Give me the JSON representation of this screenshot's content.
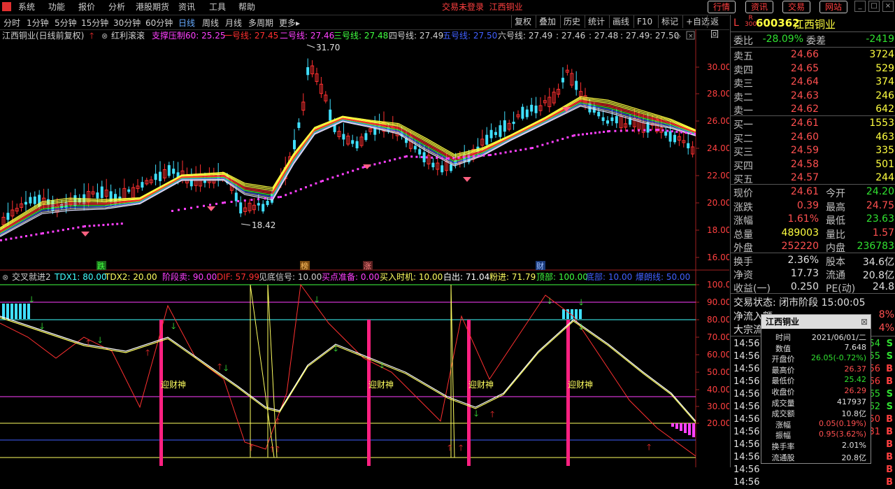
{
  "menu": [
    "系统",
    "功能",
    "报价",
    "分析",
    "港股期货",
    "资讯",
    "工具",
    "帮助"
  ],
  "login_notice": "交易未登录",
  "login_stock": "江西铜业",
  "top_buttons": [
    "行情",
    "资讯",
    "交易",
    "网站"
  ],
  "periods": [
    "分时",
    "1分钟",
    "5分钟",
    "15分钟",
    "30分钟",
    "60分钟",
    "日线",
    "周线",
    "月线",
    "多周期",
    "更多"
  ],
  "tools": [
    "复权",
    "叠加",
    "历史",
    "统计",
    "画线",
    "F10",
    "标记",
    "+自选",
    "返回"
  ],
  "main_legend": {
    "title": "江西铜业(日线前复权)",
    "indicator": "红利滚滚",
    "items": [
      {
        "text": "支撑压制60: 25.25",
        "color": "#ff40ff"
      },
      {
        "text": "一号线: 27.45",
        "color": "#ff3030"
      },
      {
        "text": "二号线: 27.46",
        "color": "#ff40ff"
      },
      {
        "text": "三号线: 27.48",
        "color": "#40ff40"
      },
      {
        "text": "四号线: 27.49",
        "color": "#d0d0d0"
      },
      {
        "text": "五号线: 27.50",
        "color": "#4060ff"
      },
      {
        "text": "六号线: 27.49",
        "color": "#d0d0d0"
      },
      {
        "text": ": 27.46",
        "color": "#d0d0d0"
      },
      {
        "text": ": 27.48",
        "color": "#d0d0d0"
      },
      {
        "text": ": 27.49",
        "color": "#d0d0d0"
      },
      {
        "text": ": 27.50",
        "color": "#d0d0d0"
      }
    ]
  },
  "sub_legend": {
    "title": "交叉就进2",
    "items": [
      {
        "text": "TDX1: 80.00",
        "color": "#40ffff"
      },
      {
        "text": "TDX2: 20.00",
        "color": "#ffff60"
      },
      {
        "text": "阶段卖: 90.00",
        "color": "#ff40ff"
      },
      {
        "text": "DIF: 57.99",
        "color": "#ff3030"
      },
      {
        "text": "见底信号: 10.00",
        "color": "#d0d0d0"
      },
      {
        "text": "买点准备: 0.00",
        "color": "#ff40ff"
      },
      {
        "text": "买入时机: 10.00",
        "color": "#ffff60"
      },
      {
        "text": "白出: 71.04",
        "color": "#ffffff"
      },
      {
        "text": "粉进: 71.79",
        "color": "#ffff60"
      },
      {
        "text": "顶部: 100.00",
        "color": "#40ff40"
      },
      {
        "text": "底部: 10.00",
        "color": "#4060ff"
      },
      {
        "text": "爆朗线: 50.00",
        "color": "#4060ff"
      }
    ]
  },
  "price_axis": [
    "30.00",
    "28.00",
    "26.00",
    "24.00",
    "22.00",
    "20.00",
    "18.00",
    "16.00"
  ],
  "sub_axis": [
    "100.00",
    "90.00",
    "80.00",
    "70.00",
    "60.00",
    "50.00",
    "40.00",
    "30.00",
    "20.00"
  ],
  "annotations": {
    "high": "31.70",
    "low": "18.42",
    "tags": [
      "跌",
      "榜",
      "涨",
      "财"
    ],
    "signal": "迎财神"
  },
  "quote": {
    "code": "600362",
    "name": "江西铜业",
    "board_label": "R",
    "board_sub": "300",
    "weibi_label": "委比",
    "weibi": "-28.09%",
    "weicha_label": "委差",
    "weicha": "-2419",
    "sells": [
      {
        "label": "卖五",
        "price": "24.66",
        "vol": "3724"
      },
      {
        "label": "卖四",
        "price": "24.65",
        "vol": "529"
      },
      {
        "label": "卖三",
        "price": "24.64",
        "vol": "374"
      },
      {
        "label": "卖二",
        "price": "24.63",
        "vol": "246"
      },
      {
        "label": "卖一",
        "price": "24.62",
        "vol": "642"
      }
    ],
    "buys": [
      {
        "label": "买一",
        "price": "24.61",
        "vol": "1553"
      },
      {
        "label": "买二",
        "price": "24.60",
        "vol": "463"
      },
      {
        "label": "买三",
        "price": "24.59",
        "vol": "335"
      },
      {
        "label": "买四",
        "price": "24.58",
        "vol": "501"
      },
      {
        "label": "买五",
        "price": "24.57",
        "vol": "244"
      }
    ],
    "stats": [
      {
        "l1": "现价",
        "v1": "24.61",
        "c1": "red",
        "l2": "今开",
        "v2": "24.20",
        "c2": "green"
      },
      {
        "l1": "涨跌",
        "v1": "0.39",
        "c1": "red",
        "l2": "最高",
        "v2": "24.75",
        "c2": "red"
      },
      {
        "l1": "涨幅",
        "v1": "1.61%",
        "c1": "red",
        "l2": "最低",
        "v2": "23.63",
        "c2": "green"
      },
      {
        "l1": "总量",
        "v1": "489003",
        "c1": "yellow",
        "l2": "量比",
        "v2": "1.57",
        "c2": "red"
      },
      {
        "l1": "外盘",
        "v1": "252220",
        "c1": "red",
        "l2": "内盘",
        "v2": "236783",
        "c2": "green"
      }
    ],
    "stats2": [
      {
        "l1": "换手",
        "v1": "2.36%",
        "l2": "股本",
        "v2": "34.6亿"
      },
      {
        "l1": "净资",
        "v1": "17.73",
        "l2": "流通",
        "v2": "20.8亿"
      },
      {
        "l1": "收益(一)",
        "v1": "0.250",
        "l2": "PE(动)",
        "v2": "24.8"
      }
    ],
    "status": "交易状态: 闭市阶段 15:00:05",
    "netflow_label": "净流入额",
    "netflow_pct": "8%",
    "bigdeal_label": "大宗流",
    "bigdeal_pct": "4%",
    "ticks": [
      {
        "time": "14:56",
        "side": "S"
      },
      {
        "time": "14:56",
        "side": "S"
      },
      {
        "time": "14:56",
        "side": "B"
      },
      {
        "time": "14:56",
        "side": "B"
      },
      {
        "time": "14:56",
        "side": "S"
      },
      {
        "time": "14:56",
        "side": "S"
      },
      {
        "time": "14:56",
        "side": "B"
      },
      {
        "time": "14:56",
        "side": "B"
      },
      {
        "time": "14:56",
        "side": "B"
      },
      {
        "time": "14:56",
        "side": "B"
      },
      {
        "time": "14:56",
        "side": "B"
      },
      {
        "time": "14:56",
        "side": "B"
      }
    ],
    "tick_tail": [
      "54",
      "55",
      "56",
      "66",
      "65",
      "62",
      "50",
      "31"
    ]
  },
  "popup": {
    "title": "江西铜业",
    "rows": [
      {
        "k": "时间",
        "v": "2021/06/01/二",
        "c": "white"
      },
      {
        "k": "数值",
        "v": "7.648",
        "c": "white"
      },
      {
        "k": "开盘价",
        "v": "26.05(-0.72%)",
        "c": "green"
      },
      {
        "k": "最高价",
        "v": "26.37",
        "c": "red"
      },
      {
        "k": "最低价",
        "v": "25.42",
        "c": "green"
      },
      {
        "k": "收盘价",
        "v": "26.29",
        "c": "red"
      },
      {
        "k": "成交量",
        "v": "417937",
        "c": "white"
      },
      {
        "k": "成交额",
        "v": "10.8亿",
        "c": "white"
      },
      {
        "k": "涨幅",
        "v": "0.05(0.19%)",
        "c": "red"
      },
      {
        "k": "振幅",
        "v": "0.95(3.62%)",
        "c": "red"
      },
      {
        "k": "换手率",
        "v": "2.01%",
        "c": "white"
      },
      {
        "k": "流通股",
        "v": "20.8亿",
        "c": "white"
      }
    ]
  }
}
